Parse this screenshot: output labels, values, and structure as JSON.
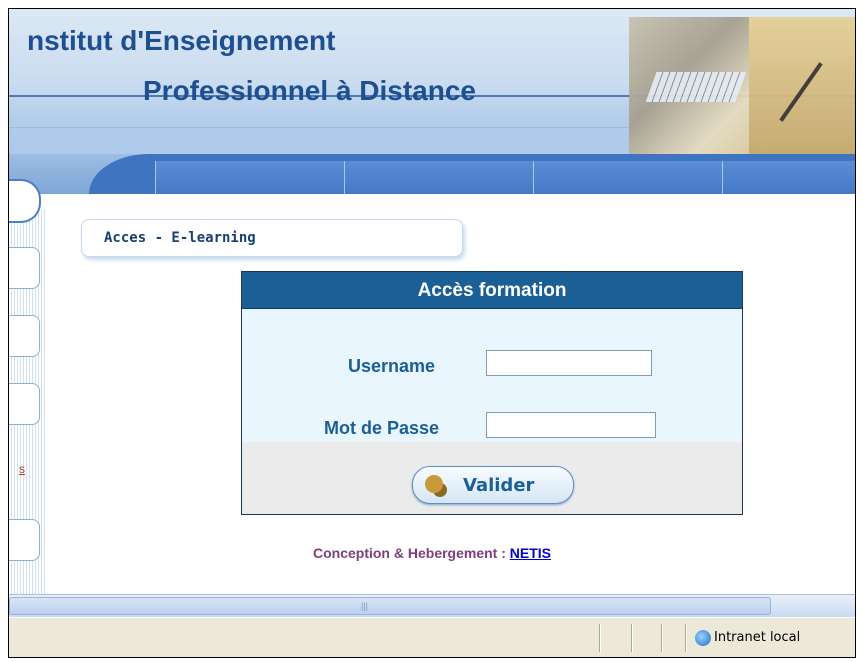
{
  "header": {
    "title_line1": "nstitut d'Enseignement",
    "title_line2": "Professionnel à Distance"
  },
  "section": {
    "title": "Acces - E-learning"
  },
  "left_nav": {
    "partial_link": "s"
  },
  "login": {
    "heading": "Accès formation",
    "username_label": "Username",
    "username_value": "",
    "password_label": "Mot de Passe",
    "password_value": "",
    "submit_label": "Valider"
  },
  "footer": {
    "credit_text": "Conception & Hebergement : ",
    "credit_link": "NETIS"
  },
  "statusbar": {
    "zone_label": "Intranet local"
  },
  "colors": {
    "brand": "#1b5f97",
    "banner": "#3f74c1",
    "credit": "#7d3f80"
  },
  "icons": [
    "key-icon",
    "globe-icon"
  ]
}
